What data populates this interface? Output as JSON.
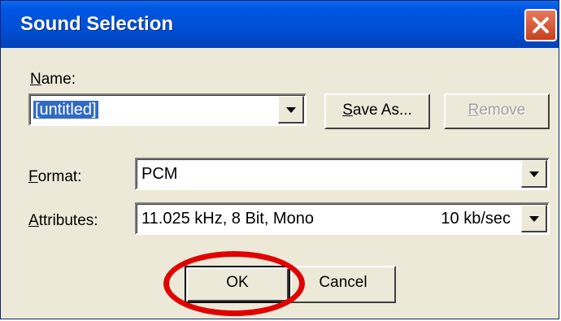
{
  "dialog": {
    "title": "Sound Selection",
    "close_icon": "close-icon"
  },
  "name_section": {
    "label_underline": "N",
    "label_rest": "ame:",
    "value": "[untitled]",
    "save_as_underline": "S",
    "save_as_rest": "ave As...",
    "remove_underline": "R",
    "remove_rest": "emove"
  },
  "format": {
    "label_underline": "F",
    "label_rest": "ormat:",
    "value": "PCM"
  },
  "attributes": {
    "label_underline": "A",
    "label_rest": "ttributes:",
    "value": "11.025 kHz, 8 Bit, Mono",
    "rate": "10 kb/sec"
  },
  "buttons": {
    "ok": "OK",
    "cancel": "Cancel"
  },
  "colors": {
    "titlebar": "#0155de",
    "dialog_bg": "#ece9d8",
    "selection": "#316ac5",
    "highlight_ring": "#e10000"
  }
}
